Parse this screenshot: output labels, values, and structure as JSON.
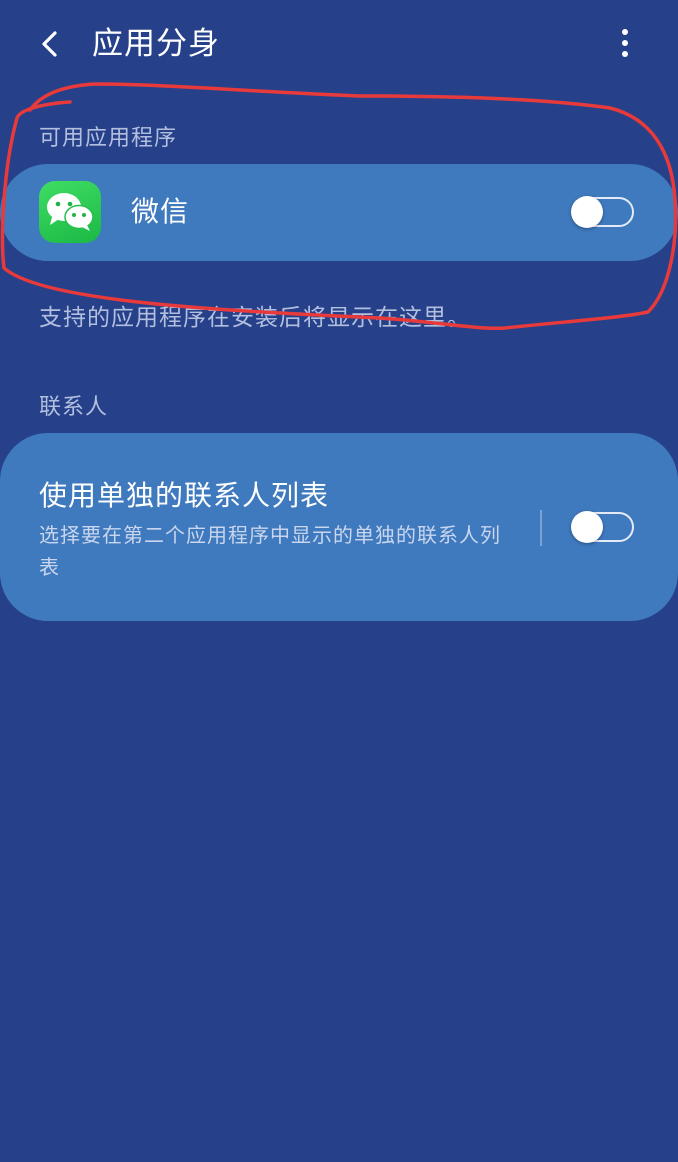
{
  "header": {
    "title": "应用分身",
    "back_icon": "back-arrow-icon",
    "more_icon": "more-vert-icon"
  },
  "available_apps": {
    "label": "可用应用程序",
    "items": [
      {
        "name": "微信",
        "icon": "wechat-icon",
        "enabled": false
      }
    ],
    "hint": "支持的应用程序在安装后将显示在这里。"
  },
  "contacts": {
    "label": "联系人",
    "setting_title": "使用单独的联系人列表",
    "setting_desc": "选择要在第二个应用程序中显示的单独的联系人列表",
    "enabled": false
  },
  "colors": {
    "background": "#26418a",
    "card": "#3f79be",
    "annotation": "#e83a3a",
    "wechat_green": "#2ac84f"
  }
}
